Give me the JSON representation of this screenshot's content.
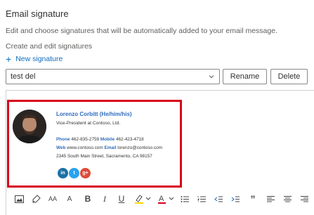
{
  "header": {
    "title": "Email signature",
    "description": "Edit and choose signatures that will be automatically added to your email message.",
    "subtitle": "Create and edit signatures"
  },
  "new_signature": {
    "label": "New signature",
    "icon": "plus-icon"
  },
  "signature_select": {
    "value": "test del",
    "icon": "chevron-down-icon"
  },
  "buttons": {
    "rename": "Rename",
    "delete": "Delete"
  },
  "signature": {
    "name": "Lorenzo Corbitt (He/him/his)",
    "role": "Vice-President at Contoso, Ltd.",
    "phone_label": "Phone",
    "phone": "462-835-2759",
    "mobile_label": "Mobile",
    "mobile": "462-423-4718",
    "web_label": "Web",
    "web": "www.contoso.com",
    "email_label": "Email",
    "email": "lorenzo@contoso.com",
    "address": "2345 South Main Street, Sacramento, CA 98157",
    "social": [
      {
        "name": "linkedin-icon",
        "glyph": "in",
        "color": "#1d6fa5"
      },
      {
        "name": "twitter-icon",
        "glyph": "t",
        "color": "#2aa2ee"
      },
      {
        "name": "google-plus-icon",
        "glyph": "g+",
        "color": "#dd4b39"
      }
    ]
  },
  "colors": {
    "accent": "#0f6cbd",
    "highlight_border": "#d9001b",
    "name_blue": "#2f6cbf"
  },
  "toolbar": {
    "items": [
      "image-icon",
      "format-painter-icon",
      "font-size-icon",
      "grow-font-icon",
      "bold-icon",
      "italic-icon",
      "underline-icon",
      "highlight-icon",
      "font-color-icon",
      "bullets-icon",
      "numbering-icon",
      "decrease-indent-icon",
      "increase-indent-icon",
      "quote-icon",
      "align-left-icon",
      "align-center-icon",
      "align-right-icon"
    ],
    "font_size_glyph": "AA",
    "grow_font_glyph": "A",
    "bold_glyph": "B",
    "italic_glyph": "I",
    "underline_glyph": "U",
    "quote_glyph": "”"
  }
}
